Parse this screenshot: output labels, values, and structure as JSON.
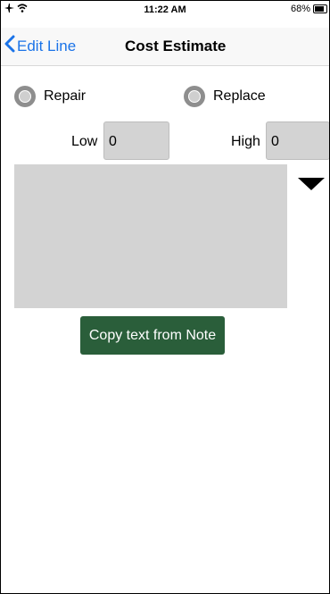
{
  "status_bar": {
    "time": "11:22 AM",
    "battery": "68%",
    "battery_level": 0.68,
    "airplane_icon": "airplane-icon",
    "wifi_icon": "wifi-icon"
  },
  "nav": {
    "back_label": "Edit Line",
    "title": "Cost Estimate",
    "accent_color": "#1a73e8"
  },
  "options": {
    "repair_label": "Repair",
    "replace_label": "Replace"
  },
  "estimate": {
    "low_label": "Low",
    "low_value": "0",
    "high_label": "High",
    "high_value": "0"
  },
  "note": {
    "text": ""
  },
  "actions": {
    "copy_label": "Copy text from Note",
    "copy_color": "#2a5e3a"
  }
}
